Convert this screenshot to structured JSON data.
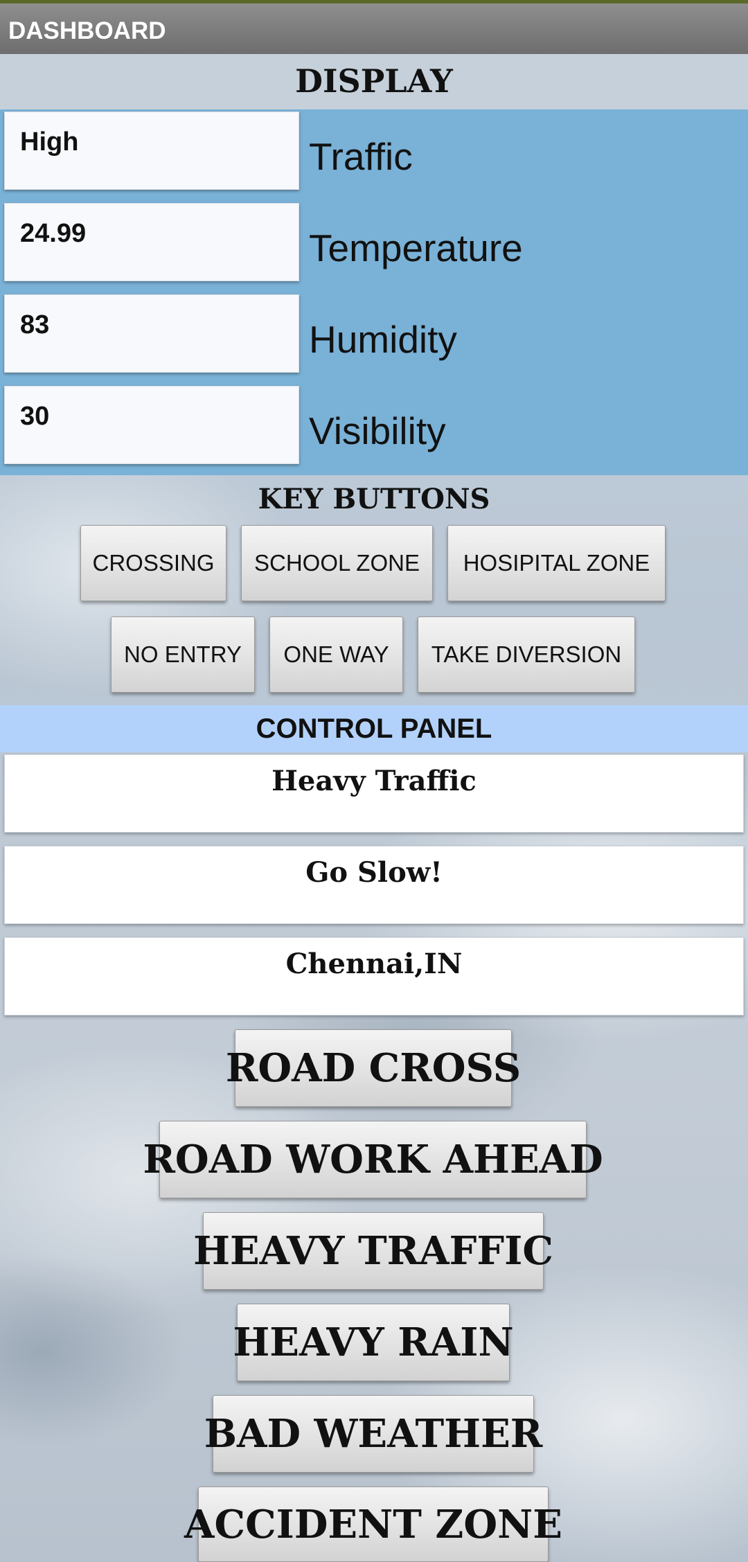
{
  "app_bar": {
    "title": "DASHBOARD"
  },
  "display": {
    "heading": "DISPLAY",
    "rows": [
      {
        "value": "High",
        "label": "Traffic"
      },
      {
        "value": "24.99",
        "label": "Temperature"
      },
      {
        "value": "83",
        "label": "Humidity"
      },
      {
        "value": "30",
        "label": "Visibility"
      }
    ]
  },
  "key_buttons": {
    "heading": "KEY BUTTONS",
    "row1": [
      "CROSSING",
      "SCHOOL ZONE",
      "HOSIPITAL ZONE"
    ],
    "row2": [
      "NO ENTRY",
      "ONE WAY",
      "TAKE DIVERSION"
    ]
  },
  "control_panel": {
    "heading": "CONTROL PANEL",
    "fields": [
      "Heavy Traffic",
      "Go Slow!",
      "Chennai,IN"
    ],
    "buttons": [
      "ROAD CROSS",
      "ROAD WORK AHEAD",
      "HEAVY TRAFFIC",
      "HEAVY RAIN",
      "BAD WEATHER",
      "ACCIDENT ZONE"
    ]
  },
  "colors": {
    "app_bar": "#7a7a7a",
    "display_panel": "#7ab1d7",
    "control_bar": "#b3d2fb"
  }
}
